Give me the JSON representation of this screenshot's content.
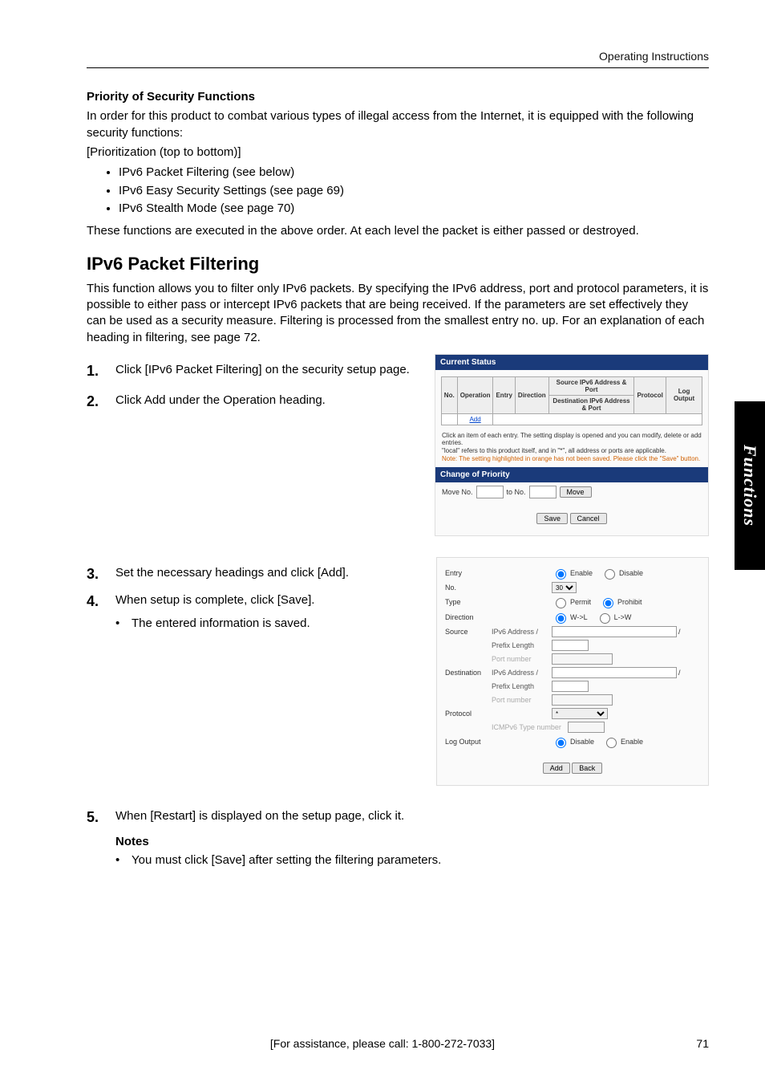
{
  "header": {
    "right": "Operating Instructions"
  },
  "sec1": {
    "title": "Priority of Security Functions",
    "p1": "In order for this product to combat various types of illegal access from the Internet, it is equipped with the following security functions:",
    "p2": "[Prioritization (top to bottom)]",
    "bullets": [
      "IPv6 Packet Filtering (see below)",
      "IPv6 Easy Security Settings (see page 69)",
      "IPv6 Stealth Mode (see page 70)"
    ],
    "p3": "These functions are executed in the above order. At each level the packet is either passed or destroyed."
  },
  "sec2": {
    "title": "IPv6 Packet Filtering",
    "intro": "This function allows you to filter only IPv6 packets. By specifying the IPv6 address, port and protocol parameters, it is possible to either pass or intercept IPv6 packets that are being received. If the parameters are set effectively they can be used as a security measure. Filtering is processed from the smallest entry no. up. For an explanation of each heading in filtering, see page 72."
  },
  "steps": {
    "s1": {
      "num": "1.",
      "text": "Click [IPv6 Packet Filtering] on the security setup page."
    },
    "s2": {
      "num": "2.",
      "text": "Click Add under the Operation heading."
    },
    "s3": {
      "num": "3.",
      "text": "Set the necessary headings and click [Add]."
    },
    "s4": {
      "num": "4.",
      "text": "When setup is complete, click [Save].",
      "sub": "The entered information is saved."
    },
    "s5": {
      "num": "5.",
      "text": "When [Restart] is displayed on the setup page, click it."
    }
  },
  "notes": {
    "heading": "Notes",
    "items": [
      "You must click [Save] after setting the filtering parameters."
    ]
  },
  "panel1": {
    "hdr": "Current Status",
    "th": {
      "no": "No.",
      "op": "Operation",
      "entry": "Entry",
      "dir": "Direction",
      "src": "Source IPv6 Address & Port",
      "dst": "Destination IPv6 Address & Port",
      "proto": "Protocol",
      "log": "Log Output"
    },
    "add": "Add",
    "note1": "Click an item of each entry. The setting display is opened and you can modify, delete or add entries.",
    "note2": "\"local\" refers to this product itself, and in \"*\", all address or ports are applicable.",
    "note3": "Note: The setting highlighted in orange has not been saved. Please click the \"Save\" button.",
    "hdr2": "Change of Priority",
    "moveNo": "Move No.",
    "toNo": "to No.",
    "moveBtn": "Move",
    "save": "Save",
    "cancel": "Cancel"
  },
  "panel2": {
    "entry": "Entry",
    "enable": "Enable",
    "disable": "Disable",
    "no": "No.",
    "noVal": "30",
    "type": "Type",
    "permit": "Permit",
    "prohibit": "Prohibit",
    "direction": "Direction",
    "wl": "W->L",
    "lw": "L->W",
    "source": "Source",
    "destination": "Destination",
    "ipv6": "IPv6 Address /",
    "prefix": "Prefix Length",
    "port": "Port number",
    "protocol": "Protocol",
    "protoVal": "*",
    "icmp": "ICMPv6 Type number",
    "log": "Log Output",
    "add": "Add",
    "back": "Back"
  },
  "sideTab": "Functions",
  "footer": {
    "center": "[For assistance, please call: 1-800-272-7033]",
    "right": "71"
  }
}
